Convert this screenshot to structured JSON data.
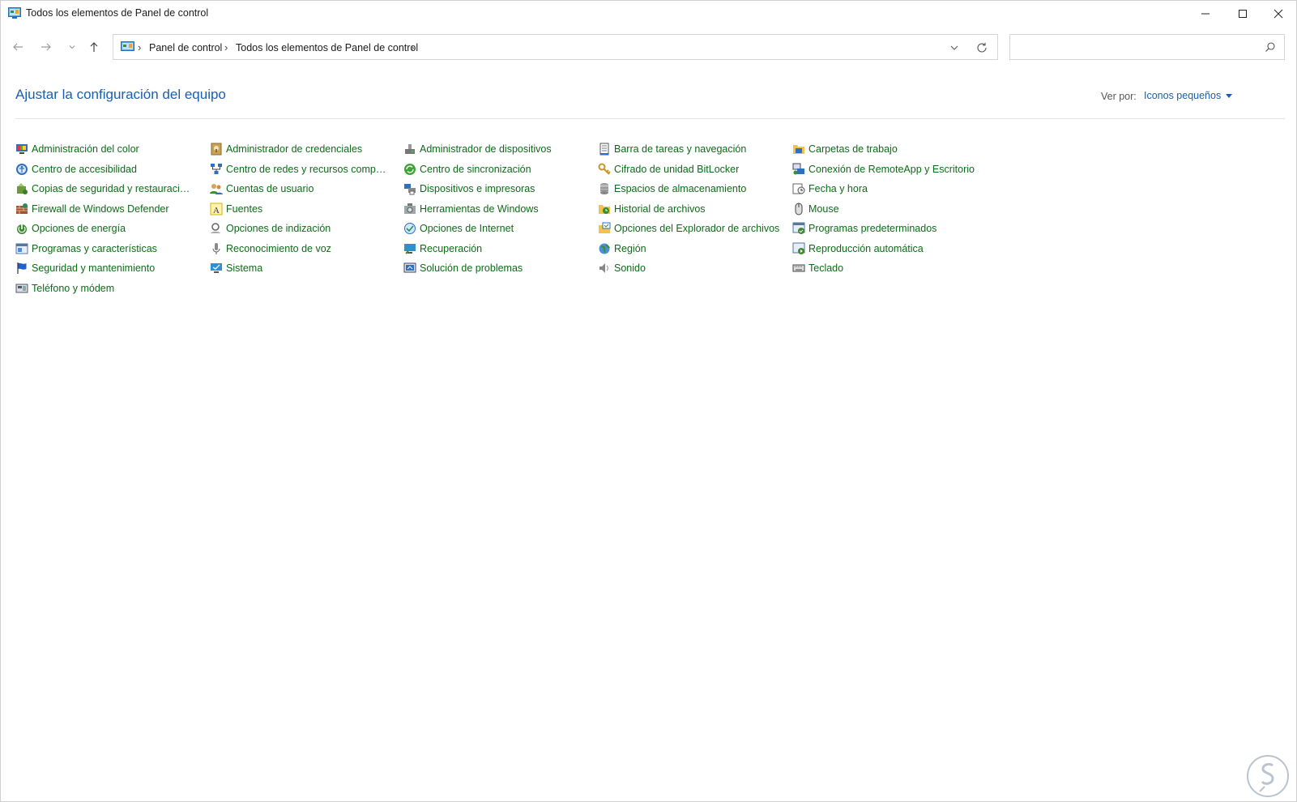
{
  "window": {
    "title": "Todos los elementos de Panel de control",
    "controls": [
      "minimize-icon",
      "maximize-icon",
      "close-icon"
    ]
  },
  "navigation": {
    "back_icon": "arrow-left-icon",
    "forward_icon": "arrow-right-icon",
    "recent_icon": "chevron-down-icon",
    "up_icon": "arrow-up-icon"
  },
  "address": {
    "breadcrumbs": [
      "Panel de control",
      "Todos los elementos de Panel de control"
    ],
    "separator": "›"
  },
  "search": {
    "placeholder": "",
    "value": ""
  },
  "header": {
    "title": "Ajustar la configuración del equipo",
    "view_by_label": "Ver por:",
    "view_by_value": "Iconos pequeños"
  },
  "columns": [
    {
      "items": [
        {
          "label": "Administración del color",
          "icon": "monitor-color-icon"
        },
        {
          "label": "Centro de accesibilidad",
          "icon": "accessibility-icon"
        },
        {
          "label": "Copias de seguridad y restauración (...",
          "icon": "backup-icon"
        },
        {
          "label": "Firewall de Windows Defender",
          "icon": "firewall-icon"
        },
        {
          "label": "Opciones de energía",
          "icon": "power-icon"
        },
        {
          "label": "Programas y características",
          "icon": "programs-icon"
        },
        {
          "label": "Seguridad y mantenimiento",
          "icon": "flag-icon"
        },
        {
          "label": "Teléfono y módem",
          "icon": "phone-modem-icon"
        }
      ]
    },
    {
      "items": [
        {
          "label": "Administrador de credenciales",
          "icon": "credentials-icon"
        },
        {
          "label": "Centro de redes y recursos comparti...",
          "icon": "network-icon"
        },
        {
          "label": "Cuentas de usuario",
          "icon": "users-icon"
        },
        {
          "label": "Fuentes",
          "icon": "fonts-icon"
        },
        {
          "label": "Opciones de indización",
          "icon": "indexing-icon"
        },
        {
          "label": "Reconocimiento de voz",
          "icon": "microphone-icon"
        },
        {
          "label": "Sistema",
          "icon": "system-icon"
        }
      ]
    },
    {
      "items": [
        {
          "label": "Administrador de dispositivos",
          "icon": "device-manager-icon"
        },
        {
          "label": "Centro de sincronización",
          "icon": "sync-icon"
        },
        {
          "label": "Dispositivos e impresoras",
          "icon": "printer-icon"
        },
        {
          "label": "Herramientas de Windows",
          "icon": "tools-icon"
        },
        {
          "label": "Opciones de Internet",
          "icon": "internet-icon"
        },
        {
          "label": "Recuperación",
          "icon": "recovery-icon"
        },
        {
          "label": "Solución de problemas",
          "icon": "troubleshoot-icon"
        }
      ]
    },
    {
      "items": [
        {
          "label": "Barra de tareas y navegación",
          "icon": "taskbar-icon"
        },
        {
          "label": "Cifrado de unidad BitLocker",
          "icon": "bitlocker-icon"
        },
        {
          "label": "Espacios de almacenamiento",
          "icon": "storage-icon"
        },
        {
          "label": "Historial de archivos",
          "icon": "file-history-icon"
        },
        {
          "label": "Opciones del Explorador de archivos",
          "icon": "folder-options-icon"
        },
        {
          "label": "Región",
          "icon": "region-icon"
        },
        {
          "label": "Sonido",
          "icon": "speaker-icon"
        }
      ]
    },
    {
      "items": [
        {
          "label": "Carpetas de trabajo",
          "icon": "work-folders-icon"
        },
        {
          "label": "Conexión de RemoteApp y Escritorio",
          "icon": "remoteapp-icon"
        },
        {
          "label": "Fecha y hora",
          "icon": "clock-icon"
        },
        {
          "label": "Mouse",
          "icon": "mouse-icon"
        },
        {
          "label": "Programas predeterminados",
          "icon": "default-programs-icon"
        },
        {
          "label": "Reproducción automática",
          "icon": "autoplay-icon"
        },
        {
          "label": "Teclado",
          "icon": "keyboard-icon"
        }
      ]
    }
  ],
  "colors": {
    "link_green": "#0e6b18",
    "title_blue": "#1a5fb4"
  },
  "watermark_icon": "solvetic-logo"
}
